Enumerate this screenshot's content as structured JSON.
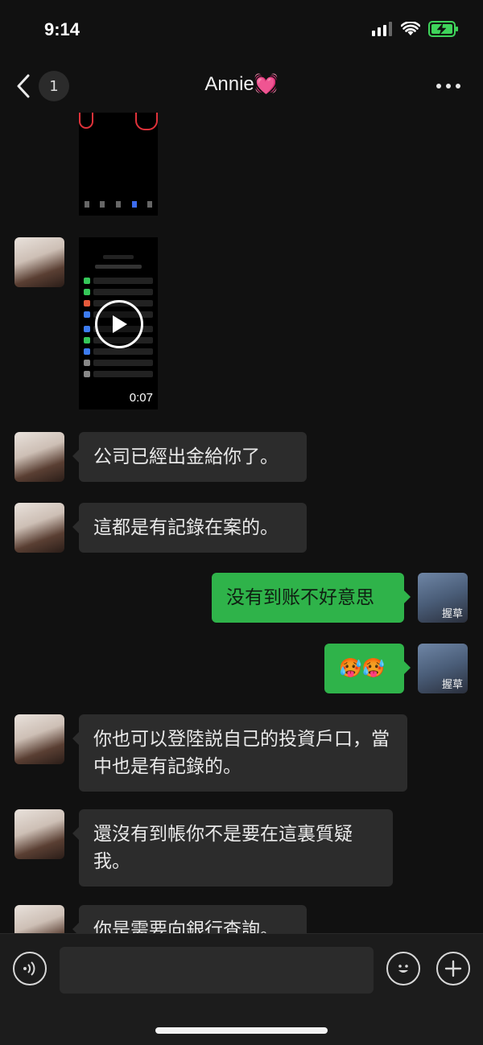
{
  "status_bar": {
    "time": "9:14"
  },
  "nav": {
    "unread_count": "1",
    "title": "Annie💓"
  },
  "video": {
    "duration": "0:07"
  },
  "messages": [
    {
      "side": "in",
      "text": "公司已經出金給你了。"
    },
    {
      "side": "in",
      "text": "這都是有記錄在案的。"
    },
    {
      "side": "out",
      "text": "没有到账不好意思"
    },
    {
      "side": "out",
      "text": "🥵🥵"
    },
    {
      "side": "in",
      "text": "你也可以登陸説自己的投資戶口，當中也是有記錄的。"
    },
    {
      "side": "in",
      "text": "還沒有到帳你不是要在這裏質疑我。"
    },
    {
      "side": "in",
      "text": "你是需要向銀行查詢。"
    }
  ],
  "self_avatar": {
    "caption": "握草"
  },
  "colors": {
    "incoming_bubble": "#2c2c2c",
    "outgoing_bubble": "#2fb34a",
    "background": "#111111"
  }
}
